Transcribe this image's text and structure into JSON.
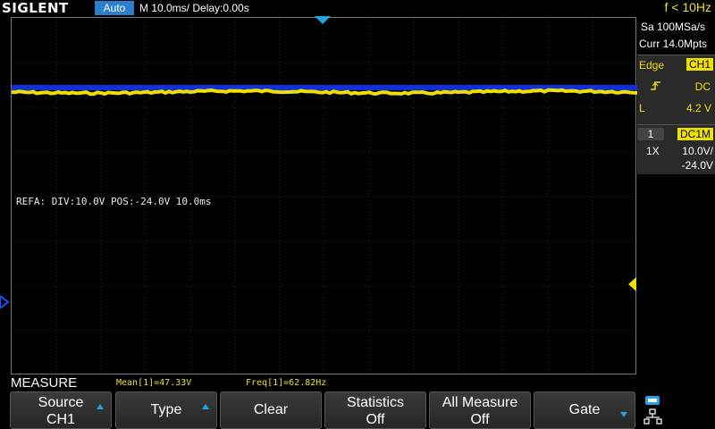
{
  "header": {
    "brand": "SIGLENT",
    "run_state": "Auto",
    "timebase": "M 10.0ms/ Delay:0.00s",
    "freq": "f < 10Hz"
  },
  "acquisition": {
    "sample_rate": "Sa 100MSa/s",
    "memory": "Curr 14.0Mpts"
  },
  "trigger": {
    "type": "Edge",
    "source": "CH1",
    "slope_icon": "rising-edge-icon",
    "coupling": "DC",
    "level_label": "L",
    "level": "4.2 V"
  },
  "channel": {
    "number": "1",
    "coupling": "DC1M",
    "probe": "1X",
    "scale": "10.0V/",
    "offset": "-24.0V"
  },
  "ref_info": "REFA: DIV:10.0V POS:-24.0V  10.0ms",
  "measure": {
    "title": "MEASURE",
    "mean": "Mean[1]=47.33V",
    "freq": "Freq[1]=62.82Hz"
  },
  "softkeys": [
    {
      "line1": "Source",
      "line2": "CH1",
      "arrow": "up"
    },
    {
      "line1": "Type",
      "line2": "",
      "arrow": "up"
    },
    {
      "line1": "Clear",
      "line2": "",
      "arrow": ""
    },
    {
      "line1": "Statistics",
      "line2": "Off",
      "arrow": ""
    },
    {
      "line1": "All Measure",
      "line2": "Off",
      "arrow": ""
    },
    {
      "line1": "Gate",
      "line2": "",
      "arrow": "down"
    }
  ],
  "colors": {
    "ch1": "#f0e000",
    "ref": "#1030e0",
    "accent": "#1fa6e0"
  }
}
